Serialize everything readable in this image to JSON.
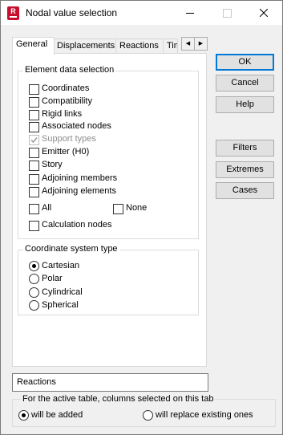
{
  "window": {
    "title": "Nodal value selection",
    "app_icon_letter": "R"
  },
  "tabs": [
    {
      "label": "General",
      "active": true
    },
    {
      "label": "Displacements",
      "active": false
    },
    {
      "label": "Reactions",
      "active": false
    },
    {
      "label": "Tim",
      "active": false
    }
  ],
  "element_data": {
    "title": "Element data selection",
    "items": [
      {
        "label": "Coordinates",
        "checked": false,
        "enabled": true
      },
      {
        "label": "Compatibility",
        "checked": false,
        "enabled": true
      },
      {
        "label": "Rigid links",
        "checked": false,
        "enabled": true
      },
      {
        "label": "Associated nodes",
        "checked": false,
        "enabled": true
      },
      {
        "label": "Support types",
        "checked": true,
        "enabled": false
      },
      {
        "label": "Emitter (H0)",
        "checked": false,
        "enabled": true
      },
      {
        "label": "Story",
        "checked": false,
        "enabled": true
      },
      {
        "label": "Adjoining members",
        "checked": false,
        "enabled": true
      },
      {
        "label": "Adjoining elements",
        "checked": false,
        "enabled": true
      }
    ],
    "all_label": "All",
    "none_label": "None",
    "calc_nodes_label": "Calculation nodes"
  },
  "coordinate_system": {
    "title": "Coordinate system type",
    "options": [
      {
        "label": "Cartesian",
        "selected": true
      },
      {
        "label": "Polar",
        "selected": false
      },
      {
        "label": "Cylindrical",
        "selected": false
      },
      {
        "label": "Spherical",
        "selected": false
      }
    ]
  },
  "buttons": {
    "ok": "OK",
    "cancel": "Cancel",
    "help": "Help",
    "filters": "Filters",
    "extremes": "Extremes",
    "cases": "Cases"
  },
  "status_field": "Reactions",
  "table_columns": {
    "title": "For the active table, columns selected on this tab",
    "option_added": "will be added",
    "option_replace": "will replace existing ones",
    "selected": "added"
  }
}
